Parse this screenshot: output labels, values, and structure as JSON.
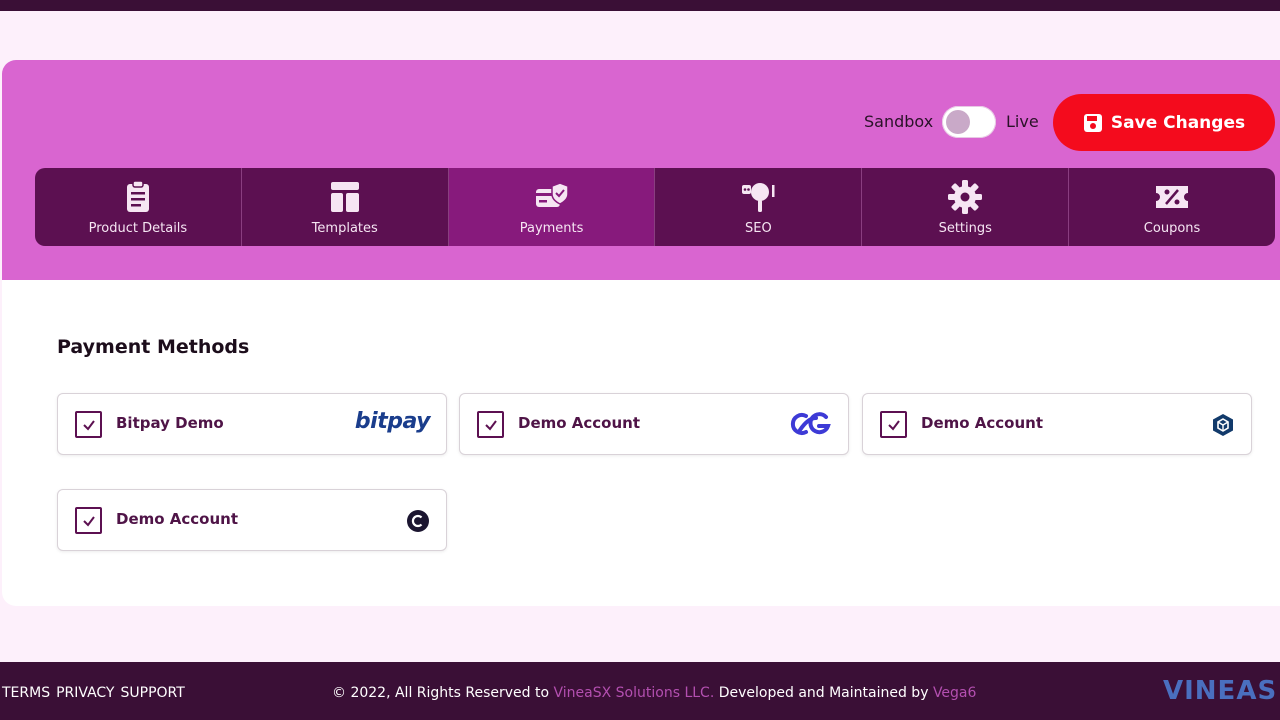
{
  "header": {
    "mode_sandbox": "Sandbox",
    "mode_live": "Live",
    "save_label": "Save Changes"
  },
  "tabs": [
    {
      "label": "Product Details",
      "icon": "clipboard-icon",
      "active": false
    },
    {
      "label": "Templates",
      "icon": "layout-icon",
      "active": false
    },
    {
      "label": "Payments",
      "icon": "payment-card-icon",
      "active": true
    },
    {
      "label": "SEO",
      "icon": "seo-icon",
      "active": false
    },
    {
      "label": "Settings",
      "icon": "gear-icon",
      "active": false
    },
    {
      "label": "Coupons",
      "icon": "coupon-icon",
      "active": false
    }
  ],
  "payment_methods": {
    "title": "Payment Methods",
    "items": [
      {
        "name": "Bitpay Demo",
        "logo": "bitpay",
        "logo_text": "bitpay",
        "checked": true
      },
      {
        "name": "Demo Account",
        "logo": "cg-logo-icon",
        "checked": true
      },
      {
        "name": "Demo Account",
        "logo": "hexagon-logo-icon",
        "checked": true
      },
      {
        "name": "Demo Account",
        "logo": "circle-c-logo-icon",
        "checked": true
      }
    ]
  },
  "footer": {
    "links": [
      "TERMS",
      "PRIVACY",
      "SUPPORT"
    ],
    "copy_prefix": "© 2022, All Rights Reserved to ",
    "company": "VineaSX Solutions LLC.",
    "copy_middle": " Developed and Maintained by ",
    "developer": "Vega6",
    "brand": "VINEAS"
  },
  "colors": {
    "hero": "#d965d0",
    "tab_bar": "#5c1051",
    "tab_active": "#871a7c",
    "save_button": "#f40b1d",
    "footer": "#3a0f36"
  }
}
